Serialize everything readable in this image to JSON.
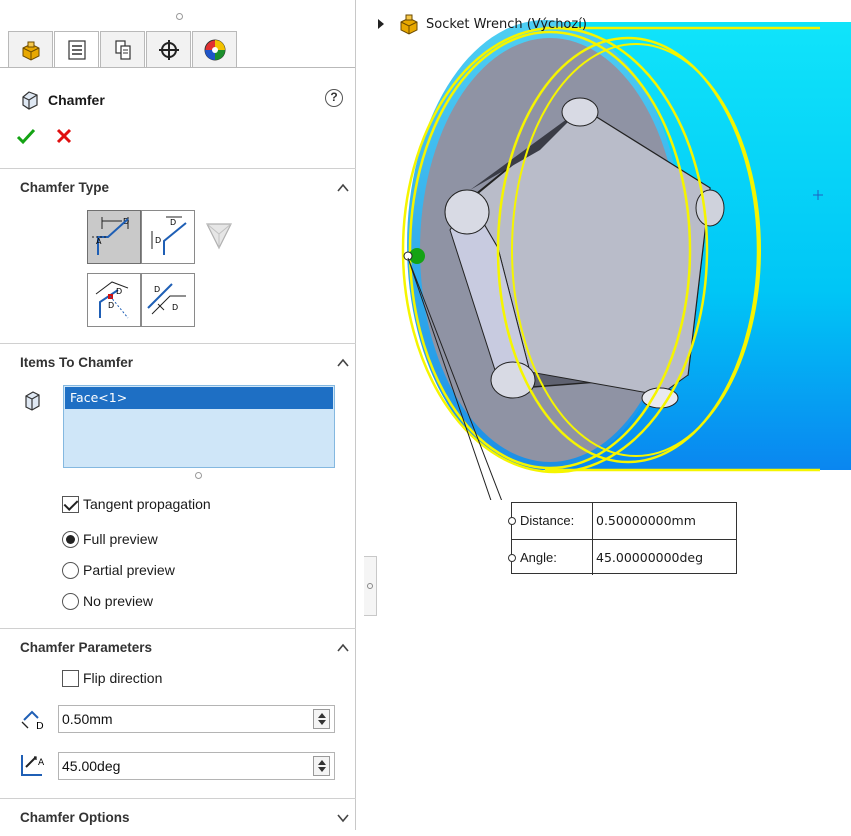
{
  "property_manager": {
    "tabs": [
      {
        "icon": "feature-manager-icon",
        "active": false
      },
      {
        "icon": "property-manager-icon",
        "active": true
      },
      {
        "icon": "configuration-manager-icon",
        "active": false
      },
      {
        "icon": "dimxpert-icon",
        "active": false
      },
      {
        "icon": "display-manager-icon",
        "active": false
      }
    ],
    "feature_title": "Chamfer",
    "help_label": "?",
    "sections": {
      "chamfer_type": {
        "title": "Chamfer Type",
        "expanded": true
      },
      "items_to_chamfer": {
        "title": "Items To Chamfer",
        "expanded": true
      },
      "chamfer_parameters": {
        "title": "Chamfer Parameters",
        "expanded": true
      },
      "chamfer_options": {
        "title": "Chamfer Options",
        "expanded": false
      }
    },
    "chamfer_type_buttons": [
      {
        "icon": "angle-distance-icon",
        "selected": true
      },
      {
        "icon": "distance-distance-icon",
        "selected": false
      },
      {
        "icon": "vertex-icon",
        "selected": false,
        "disabled": true
      },
      {
        "icon": "offset-face-icon",
        "selected": false
      },
      {
        "icon": "face-face-icon",
        "selected": false
      }
    ],
    "items_selection": [
      "Face<1>"
    ],
    "tangent_propagation": {
      "label": "Tangent propagation",
      "checked": true
    },
    "preview_options": [
      {
        "label": "Full preview",
        "selected": true
      },
      {
        "label": "Partial preview",
        "selected": false
      },
      {
        "label": "No preview",
        "selected": false
      }
    ],
    "flip_direction": {
      "label": "Flip direction",
      "checked": false
    },
    "distance_value": "0.50mm",
    "angle_value": "45.00deg"
  },
  "graphics": {
    "tree_label": "Socket Wrench  (Výchozí)",
    "callout": {
      "distance_label": "Distance:",
      "distance_value": "0.50000000mm",
      "angle_label": "Angle:",
      "angle_value": "45.00000000deg"
    },
    "colors": {
      "selection_yellow": "#f5f500",
      "cylinder_cyan": "#00d8f8",
      "face_gray": "#8f93a4",
      "accent_green": "#14a314",
      "cancel_red": "#e01010"
    }
  }
}
